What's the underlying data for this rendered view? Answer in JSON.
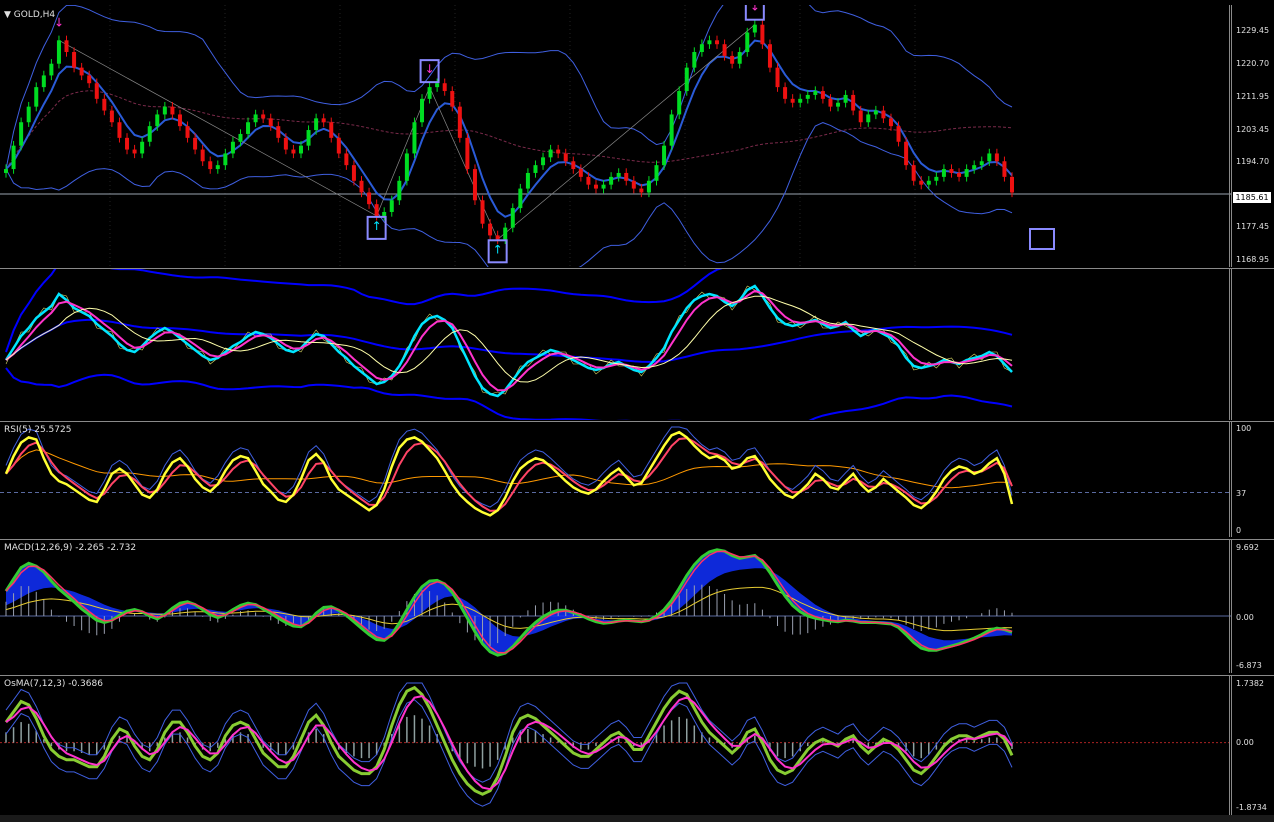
{
  "window": {
    "symbol_label": "GOLD,H4"
  },
  "colors": {
    "bull": "#00dd22",
    "bear": "#ee1111",
    "band": "#3f5fe0",
    "ma": "#2a5bd7",
    "bg": "#000000",
    "grid": "#7a7a7a",
    "cyan": "#00e5ff",
    "magenta": "#ff33cc",
    "yellow": "#ffff33",
    "orange": "#ff9900",
    "blue": "#0000ff",
    "green": "#33cc33"
  },
  "price_axis": {
    "ticks": [
      "1229.45",
      "1220.70",
      "1211.95",
      "1203.45",
      "1194.70",
      "1185.61",
      "1177.45",
      "1168.95"
    ],
    "current": "1185.61"
  },
  "rsi": {
    "label": "RSI(5) 25.5725",
    "ticks": [
      "100",
      "37",
      "0"
    ]
  },
  "macd": {
    "label": "MACD(12,26,9) -2.265 -2.732",
    "ticks": [
      "9.692",
      "0.00",
      "-6.873"
    ]
  },
  "osma": {
    "label": "OsMA(7,12,3) -0.3686",
    "ticks": [
      "1.7382",
      "0.00",
      "-1.8734"
    ]
  },
  "chart_data": [
    {
      "type": "candlestick",
      "title": "GOLD,H4",
      "ylim": [
        1168.95,
        1232.0
      ],
      "close": [
        1192,
        1198,
        1204,
        1208,
        1213,
        1216,
        1219,
        1225,
        1222,
        1218,
        1216,
        1214,
        1210,
        1207,
        1204,
        1200,
        1197,
        1196,
        1199,
        1203,
        1206,
        1208,
        1206,
        1203,
        1200,
        1197,
        1194,
        1192,
        1193,
        1196,
        1199,
        1201,
        1204,
        1206,
        1205,
        1203,
        1200,
        1197,
        1196,
        1198,
        1202,
        1205,
        1204,
        1200,
        1196,
        1193,
        1189,
        1186,
        1183,
        1180,
        1181,
        1184,
        1189,
        1196,
        1204,
        1210,
        1213,
        1214,
        1212,
        1208,
        1200,
        1192,
        1184,
        1178,
        1175,
        1174,
        1177,
        1182,
        1187,
        1191,
        1193,
        1195,
        1197,
        1196,
        1194,
        1192,
        1190,
        1188,
        1187,
        1188,
        1190,
        1191,
        1189,
        1187,
        1186,
        1189,
        1193,
        1198,
        1206,
        1212,
        1218,
        1222,
        1224,
        1225,
        1224,
        1221,
        1219,
        1222,
        1227,
        1229,
        1224,
        1218,
        1213,
        1210,
        1209,
        1210,
        1211,
        1212,
        1210,
        1208,
        1209,
        1211,
        1207,
        1204,
        1206,
        1207,
        1205,
        1203,
        1199,
        1193,
        1189,
        1188,
        1189,
        1190,
        1192,
        1191,
        1190,
        1192,
        1193,
        1194,
        1196,
        1194,
        1190,
        1186
      ],
      "upper_bollinger_note": "bands shown",
      "arrows": [
        {
          "dir": "down",
          "color": "magenta",
          "index": 7
        },
        {
          "dir": "up",
          "color": "cyan",
          "index": 49
        },
        {
          "dir": "down",
          "color": "magenta",
          "index": 56
        },
        {
          "dir": "up",
          "color": "cyan",
          "index": 65
        },
        {
          "dir": "down",
          "color": "magenta",
          "index": 99
        }
      ]
    },
    {
      "type": "line",
      "title": "RSI(5) 25.5725",
      "ylim": [
        0,
        100
      ],
      "levels": [
        37
      ],
      "values": [
        55,
        72,
        85,
        90,
        88,
        70,
        55,
        48,
        45,
        40,
        35,
        30,
        28,
        40,
        55,
        60,
        55,
        45,
        35,
        32,
        40,
        55,
        66,
        70,
        62,
        50,
        42,
        38,
        45,
        58,
        68,
        72,
        70,
        58,
        45,
        38,
        30,
        28,
        35,
        50,
        68,
        74,
        66,
        50,
        40,
        35,
        30,
        25,
        20,
        25,
        40,
        62,
        80,
        88,
        90,
        86,
        78,
        70,
        58,
        45,
        35,
        28,
        22,
        18,
        15,
        20,
        32,
        48,
        60,
        66,
        70,
        68,
        62,
        55,
        48,
        42,
        38,
        36,
        40,
        48,
        55,
        60,
        52,
        44,
        46,
        58,
        70,
        82,
        92,
        95,
        90,
        82,
        75,
        70,
        72,
        68,
        60,
        62,
        70,
        72,
        62,
        50,
        42,
        35,
        32,
        38,
        45,
        55,
        50,
        42,
        40,
        48,
        55,
        45,
        38,
        42,
        50,
        44,
        38,
        32,
        25,
        22,
        28,
        38,
        50,
        58,
        62,
        60,
        55,
        58,
        65,
        70,
        55,
        26
      ]
    },
    {
      "type": "bar",
      "title": "MACD(12,26,9) -2.265 -2.732",
      "ylim": [
        -6.873,
        9.692
      ],
      "values": [
        3.5,
        5.2,
        6.8,
        7.4,
        7.0,
        6.2,
        4.9,
        3.8,
        2.9,
        2.0,
        1.0,
        0.2,
        -0.6,
        -0.9,
        -0.6,
        0.1,
        0.7,
        0.9,
        0.6,
        0.0,
        -0.4,
        0.2,
        1.1,
        1.8,
        2.0,
        1.6,
        0.9,
        0.2,
        -0.2,
        0.2,
        0.9,
        1.5,
        1.8,
        1.6,
        1.0,
        0.4,
        -0.3,
        -0.9,
        -1.4,
        -1.5,
        -0.8,
        0.4,
        1.2,
        1.3,
        0.8,
        0.1,
        -0.8,
        -1.7,
        -2.6,
        -3.3,
        -3.4,
        -2.6,
        -1.0,
        0.9,
        2.7,
        4.1,
        4.9,
        5.0,
        4.5,
        3.3,
        1.6,
        -0.3,
        -2.2,
        -3.9,
        -5.0,
        -5.5,
        -5.2,
        -4.3,
        -3.1,
        -1.9,
        -0.9,
        -0.1,
        0.5,
        0.8,
        0.8,
        0.5,
        0.1,
        -0.4,
        -0.8,
        -1.0,
        -0.9,
        -0.7,
        -0.6,
        -0.7,
        -0.8,
        -0.6,
        0.0,
        0.9,
        2.2,
        3.9,
        5.7,
        7.2,
        8.3,
        9.0,
        9.3,
        9.1,
        8.5,
        8.1,
        8.3,
        8.5,
        7.6,
        6.1,
        4.4,
        2.8,
        1.5,
        0.6,
        0.0,
        -0.3,
        -0.5,
        -0.7,
        -0.8,
        -0.6,
        -0.7,
        -0.9,
        -0.9,
        -0.9,
        -1.0,
        -1.1,
        -1.6,
        -2.6,
        -3.7,
        -4.5,
        -4.8,
        -4.8,
        -4.5,
        -4.2,
        -3.9,
        -3.5,
        -3.1,
        -2.6,
        -2.0,
        -1.7,
        -1.9,
        -2.27
      ],
      "signal": [
        1.5,
        2.0,
        2.6,
        3.2,
        3.6,
        3.9,
        4.0,
        3.9,
        3.7,
        3.4,
        3.0,
        2.6,
        2.1,
        1.6,
        1.2,
        0.9,
        0.7,
        0.6,
        0.6,
        0.5,
        0.4,
        0.4,
        0.5,
        0.7,
        0.9,
        1.0,
        1.0,
        0.9,
        0.7,
        0.6,
        0.7,
        0.8,
        1.0,
        1.1,
        1.1,
        1.0,
        0.8,
        0.5,
        0.2,
        -0.1,
        -0.2,
        -0.1,
        0.1,
        0.3,
        0.4,
        0.3,
        0.1,
        -0.3,
        -0.7,
        -1.2,
        -1.6,
        -1.8,
        -1.7,
        -1.2,
        -0.4,
        0.5,
        1.4,
        2.1,
        2.6,
        2.8,
        2.6,
        2.0,
        1.2,
        0.2,
        -0.8,
        -1.7,
        -2.4,
        -2.8,
        -2.9,
        -2.7,
        -2.4,
        -2.0,
        -1.5,
        -1.1,
        -0.7,
        -0.4,
        -0.3,
        -0.3,
        -0.4,
        -0.5,
        -0.6,
        -0.6,
        -0.6,
        -0.6,
        -0.7,
        -0.7,
        -0.5,
        -0.2,
        0.3,
        1.0,
        1.9,
        2.9,
        3.9,
        4.8,
        5.5,
        6.0,
        6.3,
        6.5,
        6.6,
        6.7,
        6.7,
        6.4,
        5.8,
        5.0,
        4.1,
        3.2,
        2.4,
        1.6,
        1.0,
        0.5,
        0.1,
        -0.2,
        -0.3,
        -0.5,
        -0.6,
        -0.7,
        -0.7,
        -0.8,
        -1.0,
        -1.4,
        -1.9,
        -2.4,
        -2.9,
        -3.2,
        -3.4,
        -3.4,
        -3.3,
        -3.2,
        -3.1,
        -3.0,
        -2.9,
        -2.8,
        -2.7,
        -2.73
      ]
    },
    {
      "type": "bar",
      "title": "OsMA(7,12,3) -0.3686",
      "ylim": [
        -1.8734,
        1.7382
      ],
      "values": [
        0.6,
        0.9,
        1.2,
        1.1,
        0.7,
        0.2,
        -0.2,
        -0.4,
        -0.5,
        -0.5,
        -0.6,
        -0.7,
        -0.7,
        -0.4,
        0.1,
        0.4,
        0.3,
        -0.1,
        -0.4,
        -0.5,
        -0.2,
        0.3,
        0.6,
        0.6,
        0.3,
        -0.1,
        -0.4,
        -0.5,
        -0.3,
        0.2,
        0.5,
        0.6,
        0.5,
        0.1,
        -0.3,
        -0.5,
        -0.7,
        -0.7,
        -0.4,
        0.1,
        0.6,
        0.8,
        0.5,
        0.0,
        -0.4,
        -0.6,
        -0.8,
        -0.9,
        -0.9,
        -0.7,
        -0.2,
        0.5,
        1.1,
        1.5,
        1.6,
        1.4,
        1.0,
        0.5,
        0.0,
        -0.5,
        -0.9,
        -1.2,
        -1.4,
        -1.5,
        -1.4,
        -1.0,
        -0.4,
        0.3,
        0.7,
        0.8,
        0.7,
        0.5,
        0.3,
        0.1,
        -0.1,
        -0.3,
        -0.4,
        -0.4,
        -0.2,
        0.0,
        0.2,
        0.3,
        0.1,
        -0.2,
        -0.2,
        0.2,
        0.6,
        1.0,
        1.3,
        1.5,
        1.4,
        1.0,
        0.6,
        0.3,
        0.1,
        -0.1,
        -0.3,
        -0.1,
        0.3,
        0.4,
        0.0,
        -0.5,
        -0.8,
        -0.9,
        -0.8,
        -0.5,
        -0.2,
        0.0,
        0.1,
        0.0,
        -0.1,
        0.1,
        0.2,
        -0.1,
        -0.3,
        -0.1,
        0.1,
        0.0,
        -0.2,
        -0.5,
        -0.8,
        -0.9,
        -0.7,
        -0.4,
        -0.1,
        0.1,
        0.2,
        0.2,
        0.1,
        0.2,
        0.3,
        0.3,
        0.1,
        -0.37
      ]
    }
  ]
}
